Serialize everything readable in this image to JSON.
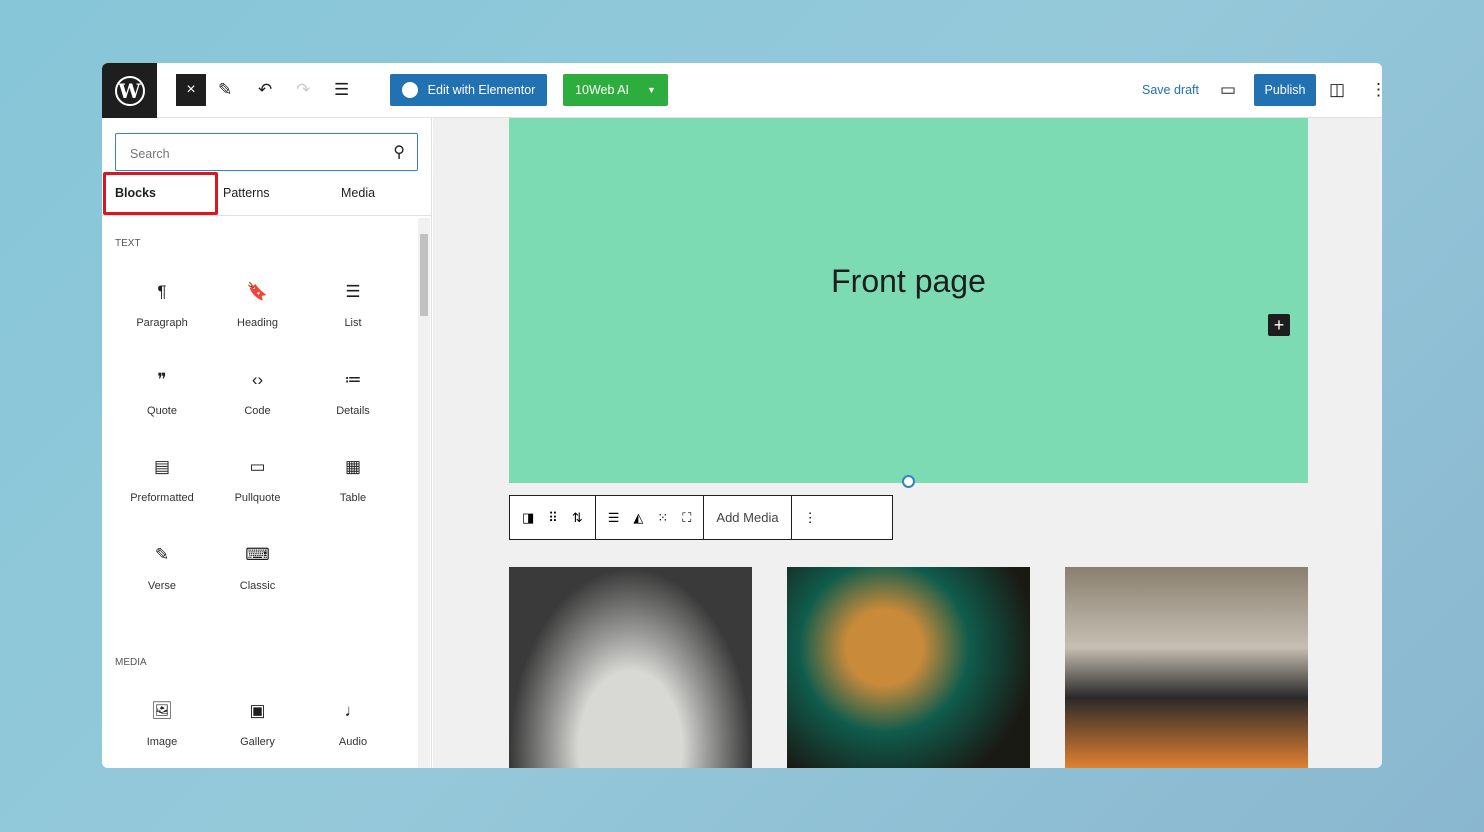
{
  "toolbar": {
    "logo": "W",
    "close_icon": "×",
    "edit_with_elementor": "Edit with Elementor",
    "tenweb_ai": "10Web AI",
    "save_draft": "Save draft",
    "publish": "Publish"
  },
  "sidebar": {
    "search_placeholder": "Search",
    "tabs": [
      "Blocks",
      "Patterns",
      "Media"
    ],
    "active_tab": "Blocks",
    "sections": [
      {
        "title": "TEXT",
        "blocks": [
          {
            "label": "Paragraph",
            "icon": "¶"
          },
          {
            "label": "Heading",
            "icon": "🔖"
          },
          {
            "label": "List",
            "icon": "☰"
          },
          {
            "label": "Quote",
            "icon": "❞"
          },
          {
            "label": "Code",
            "icon": "‹›"
          },
          {
            "label": "Details",
            "icon": "≔"
          },
          {
            "label": "Preformatted",
            "icon": "▤"
          },
          {
            "label": "Pullquote",
            "icon": "▭"
          },
          {
            "label": "Table",
            "icon": "▦"
          },
          {
            "label": "Verse",
            "icon": "✎"
          },
          {
            "label": "Classic",
            "icon": "⌨"
          }
        ]
      },
      {
        "title": "MEDIA",
        "blocks": [
          {
            "label": "Image",
            "icon": "🖼"
          },
          {
            "label": "Gallery",
            "icon": "▣"
          },
          {
            "label": "Audio",
            "icon": "♩"
          }
        ]
      }
    ]
  },
  "canvas": {
    "cover_title": "Front page",
    "cover_color": "#7ddbb4",
    "block_toolbar": {
      "add_media": "Add Media"
    }
  },
  "colors": {
    "accent": "#2271b1",
    "elementor": "#2271b1",
    "tenweb": "#2ead3f",
    "highlight": "#e0141e"
  }
}
